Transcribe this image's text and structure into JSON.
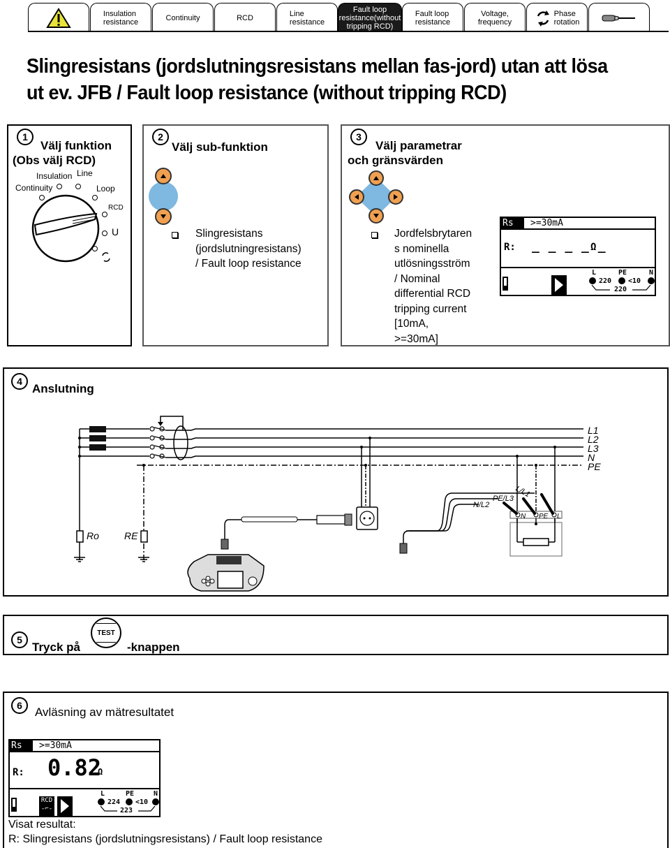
{
  "tabs": [
    {
      "label": "",
      "icon": "warning-icon"
    },
    {
      "label": "Insulation\nresistance"
    },
    {
      "label": "Continuity"
    },
    {
      "label": "RCD"
    },
    {
      "label": "Line\nresistance"
    },
    {
      "label": "Fault loop\nresistance(without\ntripping RCD)",
      "active": true
    },
    {
      "label": "Fault loop\nresistance"
    },
    {
      "label": "Voltage,\nfrequency"
    },
    {
      "label": "Phase\nrotation",
      "icon": "phase-rotation-icon"
    },
    {
      "label": "",
      "icon": "screwdriver-icon"
    }
  ],
  "title": "Slingresistans (jordslutningsresistans mellan fas-jord) utan att lösa ut ev. JFB / Fault loop resistance (without tripping RCD)",
  "step1": {
    "num": "1",
    "title_line1": "Välj funktion",
    "title_line2": "(Obs välj RCD)",
    "dial_labels": [
      "Insulation",
      "Line",
      "Continuity",
      "Loop",
      "RCD",
      "U"
    ]
  },
  "step2": {
    "num": "2",
    "title": "Välj sub-funktion",
    "bullet_lines": [
      "Slingresistans",
      "(jordslutningresistans)",
      "/ Fault loop resistance"
    ]
  },
  "step3": {
    "num": "3",
    "title_line1": "Välj parametrar",
    "title_line2": "och gränsvärden",
    "bullet_lines": [
      "Jordfelsbrytaren",
      "s nominella",
      "utlösningsström",
      "/ Nominal",
      "differential RCD",
      "tripping current",
      "[10mA,",
      ">=30mA]"
    ],
    "lcd": {
      "function": "Rs",
      "parameter": ">=30mA",
      "r_label": "R:",
      "r_value": "_ _ _ _ _",
      "unit": "Ω",
      "terminals": {
        "l": "L",
        "pe": "PE",
        "n": "N",
        "l_pe": "220",
        "pe_n": "<10",
        "l_n": "220"
      }
    }
  },
  "step4": {
    "num": "4",
    "title": "Anslutning",
    "lines": [
      "L1",
      "L2",
      "L3",
      "N",
      "PE"
    ],
    "resistors": [
      "Ro",
      "RE"
    ],
    "probe_labels": [
      "L/L1",
      "PE/L3",
      "N/L2"
    ],
    "terminal_labels": [
      "N",
      "PE",
      "L"
    ]
  },
  "step5": {
    "num": "5",
    "text_before": "Tryck på",
    "button": "TEST",
    "text_after": "-knappen"
  },
  "step6": {
    "num": "6",
    "title": "Avläsning av mätresultatet",
    "lcd": {
      "function": "Rs",
      "parameter": ">=30mA",
      "r_label": "R:",
      "r_value": "0.82",
      "unit": "Ω",
      "rcd_badge": "RCD",
      "terminals": {
        "l": "L",
        "pe": "PE",
        "n": "N",
        "l_pe": "224",
        "pe_n": "<10",
        "l_n": "223"
      }
    },
    "result_heading": "Visat resultat:",
    "result_text": "R: Slingresistans (jordslutningsresistans) / Fault loop resistance"
  },
  "colors": {
    "key_blue": "#7fb8e0",
    "key_orange": "#f0a050",
    "warning_yellow": "#e8e23a"
  }
}
